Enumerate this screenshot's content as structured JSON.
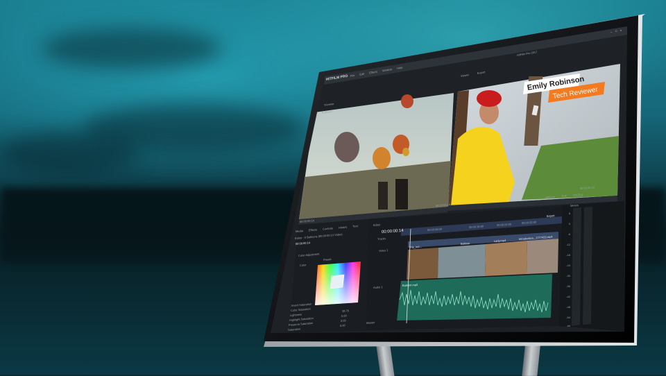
{
  "app": {
    "title": "HitFilm Pro 2017",
    "logo_text": "HITFILM PRO",
    "menu": [
      "File",
      "Edit",
      "Effects",
      "Window",
      "Help"
    ]
  },
  "left_viewer": {
    "tab": "Trimmer",
    "sub_label": "Balloons",
    "timecode": "00:00:00:14"
  },
  "right_viewer": {
    "tabs": [
      "Viewer",
      "Export"
    ],
    "timecode": "00:00:00:14",
    "options_label": "Options",
    "zoom_label": "Full",
    "fit_label": "(79.5%)",
    "end_timecode": "00:00:40:16"
  },
  "lower_third": {
    "name": "Emily Robinson",
    "role": "Tech Reviewer",
    "accent_color": "#f47a20"
  },
  "controls_panel": {
    "tabs": [
      "Media",
      "Effects",
      "Controls",
      "History",
      "Text"
    ],
    "clip_label": "Editor - 0 Balloons (00:00:00:14 Video)",
    "timecode": "00:00:00:14",
    "effect_name": "Color Adjustment",
    "preset_label": "Preset",
    "color_group": "Color",
    "properties": [
      {
        "name": "Invert Saturation",
        "value": ""
      },
      {
        "name": "Color Saturation",
        "value": ""
      },
      {
        "name": "Lightness",
        "value": "39.75"
      },
      {
        "name": "Highlight Saturation",
        "value": "0.00"
      },
      {
        "name": "Preserve Saturation",
        "value": "0.00"
      },
      {
        "name": "Saturation",
        "value": "0.00"
      }
    ]
  },
  "editor": {
    "tab": "Editor",
    "timecode": "00:00:00:14",
    "export_label": "Export",
    "tracks": [
      "Tracks",
      "Video 1",
      "Audio 1",
      "Master"
    ],
    "ruler": [
      "00:00:08:00",
      "00:00:16:00",
      "00:00:24:00",
      "00:00:32:00"
    ],
    "clips": [
      "Trip_out...",
      "Balloon",
      "Lady.mp4",
      "Introduction...1777423.mp4"
    ],
    "audio_clip": "Balloon.mp3"
  },
  "meters": {
    "tab": "Meters",
    "scale": [
      "6",
      "0",
      "-6",
      "-12",
      "-18",
      "-24",
      "-30",
      "-36",
      "-42",
      "-48",
      "-54",
      "-inf"
    ]
  }
}
